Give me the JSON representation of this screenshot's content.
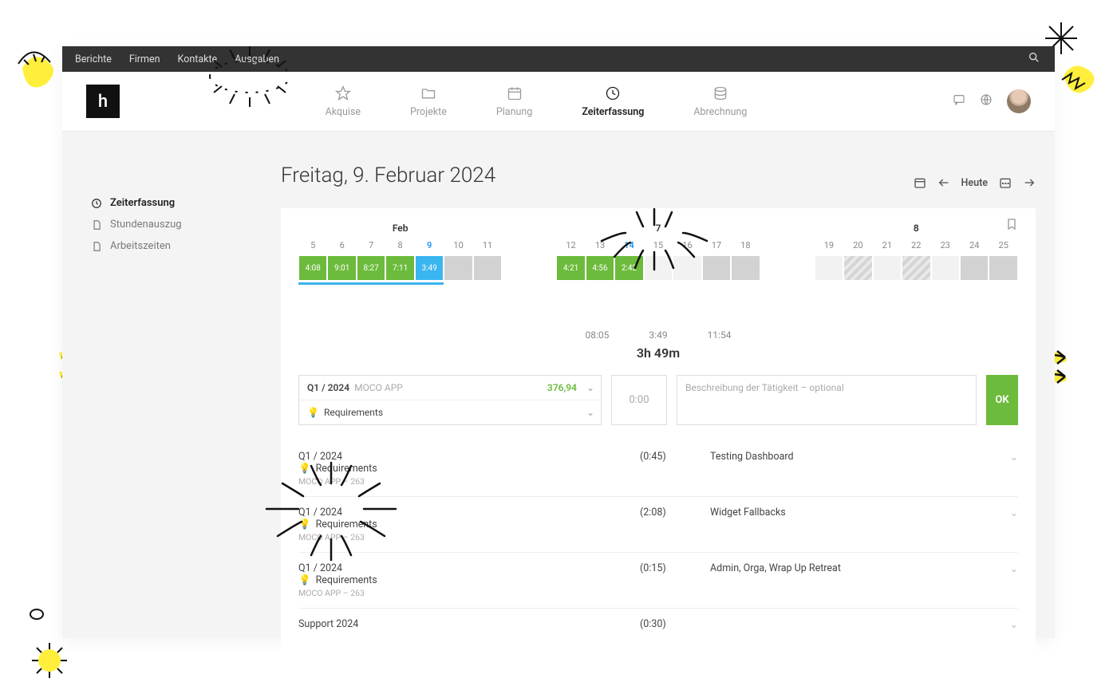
{
  "topnav": {
    "items": [
      "Berichte",
      "Firmen",
      "Kontakte",
      "Ausgaben"
    ]
  },
  "logo": "h",
  "mainnav": {
    "items": [
      {
        "label": "Akquise",
        "icon": "star"
      },
      {
        "label": "Projekte",
        "icon": "folder"
      },
      {
        "label": "Planung",
        "icon": "calendar"
      },
      {
        "label": "Zeiterfassung",
        "icon": "clock",
        "active": true
      },
      {
        "label": "Abrechnung",
        "icon": "db"
      }
    ]
  },
  "sidebar": {
    "items": [
      {
        "label": "Zeiterfassung",
        "icon": "clock",
        "active": true
      },
      {
        "label": "Stundenauszug",
        "icon": "file"
      },
      {
        "label": "Arbeitszeiten",
        "icon": "file"
      }
    ]
  },
  "page": {
    "title": "Freitag, 9. Februar 2024",
    "today_label": "Heute"
  },
  "calendar": {
    "groups": [
      {
        "month": "Feb",
        "days": [
          {
            "num": "5",
            "time": "4:08",
            "state": "green"
          },
          {
            "num": "6",
            "time": "9:01",
            "state": "green"
          },
          {
            "num": "7",
            "time": "8:27",
            "state": "green"
          },
          {
            "num": "8",
            "time": "7:11",
            "state": "green"
          },
          {
            "num": "9",
            "time": "3:49",
            "state": "blue",
            "active": true
          },
          {
            "num": "10",
            "time": "",
            "state": "grey"
          },
          {
            "num": "11",
            "time": "",
            "state": "grey"
          }
        ],
        "underline": true
      },
      {
        "month": "7",
        "days": [
          {
            "num": "12",
            "time": "4:21",
            "state": "green"
          },
          {
            "num": "13",
            "time": "4:56",
            "state": "green"
          },
          {
            "num": "14",
            "time": "2:42",
            "state": "green",
            "active": true
          },
          {
            "num": "15",
            "time": "",
            "state": "light"
          },
          {
            "num": "16",
            "time": "",
            "state": "light"
          },
          {
            "num": "17",
            "time": "",
            "state": "grey"
          },
          {
            "num": "18",
            "time": "",
            "state": "grey"
          }
        ]
      },
      {
        "month": "8",
        "days": [
          {
            "num": "19",
            "time": "",
            "state": "light"
          },
          {
            "num": "20",
            "time": "",
            "state": "hatch"
          },
          {
            "num": "21",
            "time": "",
            "state": "light"
          },
          {
            "num": "22",
            "time": "",
            "state": "hatch"
          },
          {
            "num": "23",
            "time": "",
            "state": "light"
          },
          {
            "num": "24",
            "time": "",
            "state": "grey"
          },
          {
            "num": "25",
            "time": "",
            "state": "grey"
          }
        ]
      }
    ]
  },
  "timehead": {
    "start": "08:05",
    "dur": "3:49",
    "end": "11:54"
  },
  "total": "3h 49m",
  "form": {
    "project": "Q1 / 2024",
    "project_sub": "MOCO APP",
    "budget": "376,94",
    "task": "Requirements",
    "time_placeholder": "0:00",
    "desc_placeholder": "Beschreibung der Tätigkeit – optional",
    "ok": "OK"
  },
  "entries": [
    {
      "project": "Q1 / 2024",
      "task": "Requirements",
      "meta": "MOCO APP – 263",
      "time": "(0:45)",
      "desc": "Testing Dashboard"
    },
    {
      "project": "Q1 / 2024",
      "task": "Requirements",
      "meta": "MOCO APP – 263",
      "time": "(2:08)",
      "desc": "Widget Fallbacks"
    },
    {
      "project": "Q1 / 2024",
      "task": "Requirements",
      "meta": "MOCO APP – 263",
      "time": "(0:15)",
      "desc": "Admin, Orga, Wrap Up Retreat"
    },
    {
      "project": "Support 2024",
      "task": "",
      "meta": "",
      "time": "(0:30)",
      "desc": ""
    }
  ]
}
